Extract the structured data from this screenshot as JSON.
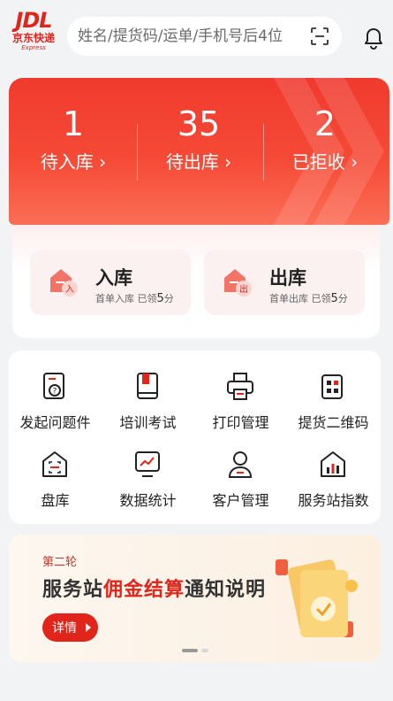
{
  "header": {
    "logo": {
      "brand": "JDL",
      "cn": "京东快递",
      "en": "Express"
    },
    "search": {
      "placeholder": "姓名/提货码/运单/手机号后4位"
    },
    "scan_icon": "scan-icon",
    "notification_icon": "bell-icon"
  },
  "stats": [
    {
      "count": "1",
      "label": "待入库 ›"
    },
    {
      "count": "35",
      "label": "待出库 ›"
    },
    {
      "count": "2",
      "label": "已拒收 ›"
    }
  ],
  "actions": [
    {
      "title": "入库",
      "subtitle_prefix": "首单入库 已领",
      "subtitle_value": "5",
      "subtitle_suffix": "分",
      "icon": "inbound-icon",
      "badge": "入"
    },
    {
      "title": "出库",
      "subtitle_prefix": "首单出库 已领",
      "subtitle_value": "5",
      "subtitle_suffix": "分",
      "icon": "outbound-icon",
      "badge": "出"
    }
  ],
  "grid": [
    {
      "label": "发起问题件",
      "icon": "question-doc-icon"
    },
    {
      "label": "培训考试",
      "icon": "book-icon"
    },
    {
      "label": "打印管理",
      "icon": "printer-icon"
    },
    {
      "label": "提货二维码",
      "icon": "qr-code-icon"
    },
    {
      "label": "盘库",
      "icon": "warehouse-scan-icon"
    },
    {
      "label": "数据统计",
      "icon": "chart-monitor-icon"
    },
    {
      "label": "客户管理",
      "icon": "user-icon"
    },
    {
      "label": "服务站指数",
      "icon": "station-index-icon"
    }
  ],
  "promo": {
    "round": "第二轮",
    "headline_part1": "服务站",
    "headline_highlight": "佣金结算",
    "headline_part2": "通知说明",
    "button": "详情",
    "illustration": "documents-check-icon"
  },
  "colors": {
    "brand_red": "#e1251b",
    "banner_top": "#f03a2e",
    "banner_bottom": "#fb6e56",
    "background": "#f2f3f5"
  },
  "carousel": {
    "pages": 2,
    "active": 1
  }
}
